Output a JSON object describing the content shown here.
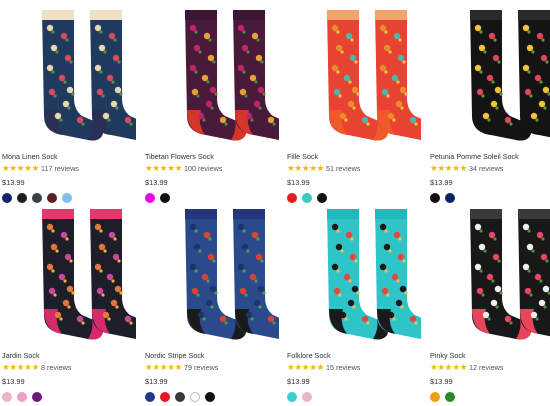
{
  "products": [
    {
      "name": "Mona Linen Sock",
      "stars": "★★★★★",
      "reviews": "117 reviews",
      "price": "$13.99",
      "swatches": [
        "#10246b",
        "#1e1e1e",
        "#3a3f4a",
        "#5b2025",
        "#7ec0e8"
      ],
      "palette": {
        "base": "#1f3a5c",
        "accent": "#e9d6b3",
        "flower": "#d84a5c",
        "leaf": "#5e8c4a",
        "cuff": "#efe2c4",
        "heel": "#2b2f56"
      }
    },
    {
      "name": "Tibetan Flowers Sock",
      "stars": "★★★★★",
      "reviews": "100 reviews",
      "price": "$13.99",
      "swatches": [
        "#e800e8",
        "#111111"
      ],
      "palette": {
        "base": "#4a1a3a",
        "accent": "#c1246a",
        "flower": "#e6a23a",
        "leaf": "#4f8a3c",
        "cuff": "#3b1733",
        "heel": "#d6362a"
      }
    },
    {
      "name": "Fille Sock",
      "stars": "★★★★★",
      "reviews": "51 reviews",
      "price": "$13.99",
      "swatches": [
        "#e31b23",
        "#3cc9c0",
        "#111111"
      ],
      "palette": {
        "base": "#e84233",
        "accent": "#f08a2a",
        "flower": "#4bb7a8",
        "leaf": "#f4c542",
        "cuff": "#f3a46a",
        "heel": "#ee5a2a"
      }
    },
    {
      "name": "Petunia Pomme Soleil Sock",
      "stars": "★★★★★",
      "reviews": "34 reviews",
      "price": "$13.99",
      "swatches": [
        "#111111",
        "#0d1f6b"
      ],
      "palette": {
        "base": "#141414",
        "accent": "#f1c232",
        "flower": "#e0455e",
        "leaf": "#5a9a3a",
        "cuff": "#2a2a2a",
        "heel": "#141414"
      }
    },
    {
      "name": "Jardin Sock",
      "stars": "★★★★★",
      "reviews": "8 reviews",
      "price": "$13.99",
      "swatches": [
        "#e8b7c4",
        "#f0a0c8",
        "#6a1b74"
      ],
      "palette": {
        "base": "#1e1e2a",
        "accent": "#e07a3a",
        "flower": "#c84a9a",
        "leaf": "#f0b030",
        "cuff": "#e03a6a",
        "heel": "#d62a6a"
      }
    },
    {
      "name": "Nordic Stripe Sock",
      "stars": "★★★★★",
      "reviews": "79 reviews",
      "price": "$13.99",
      "swatches": [
        "#1f3a8a",
        "#e31b23",
        "#3a3a3a",
        "#ffffff",
        "#111111"
      ],
      "palette": {
        "base": "#2a4a8c",
        "accent": "#1e3470",
        "flower": "#d8462e",
        "leaf": "#4c9a58",
        "cuff": "#22387a",
        "heel": "#1a1a1a"
      }
    },
    {
      "name": "Folklore Sock",
      "stars": "★★★★★",
      "reviews": "15 reviews",
      "price": "$13.99",
      "swatches": [
        "#3ccfd0",
        "#e8b7c4"
      ],
      "palette": {
        "base": "#2ec4c8",
        "accent": "#1a1a1a",
        "flower": "#e8453c",
        "leaf": "#f2c14a",
        "cuff": "#24b8bd",
        "heel": "#1a1a1a"
      }
    },
    {
      "name": "Pinky Sock",
      "stars": "★★★★★",
      "reviews": "12 reviews",
      "price": "$13.99",
      "swatches": [
        "#f0a010",
        "#2a8a2a"
      ],
      "palette": {
        "base": "#181818",
        "accent": "#f2f2f2",
        "flower": "#e8456a",
        "leaf": "#5a8a3a",
        "cuff": "#3a3a3a",
        "heel": "#e8455a"
      }
    }
  ]
}
